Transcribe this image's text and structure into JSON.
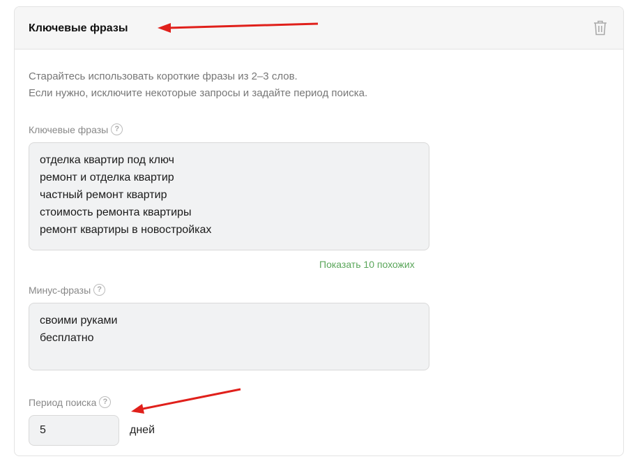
{
  "header": {
    "title": "Ключевые фразы",
    "delete_icon": "trash-icon"
  },
  "hint": [
    "Старайтесь использовать короткие фразы из 2–3 слов.",
    "Если нужно, исключите некоторые запросы и задайте период поиска."
  ],
  "keywords": {
    "label": "Ключевые фразы",
    "help": "?",
    "lines": [
      "отделка квартир под ключ",
      "ремонт и отделка квартир",
      "частный ремонт квартир",
      "стоимость ремонта квартиры",
      "ремонт квартиры в новостройках"
    ],
    "show_similar": "Показать 10 похожих"
  },
  "minus": {
    "label": "Минус-фразы",
    "help": "?",
    "lines": [
      "своими руками",
      "бесплатно"
    ]
  },
  "period": {
    "label": "Период поиска",
    "help": "?",
    "value": "5",
    "unit": "дней"
  },
  "colors": {
    "arrow": "#e0201b",
    "link": "#5aa65a"
  }
}
